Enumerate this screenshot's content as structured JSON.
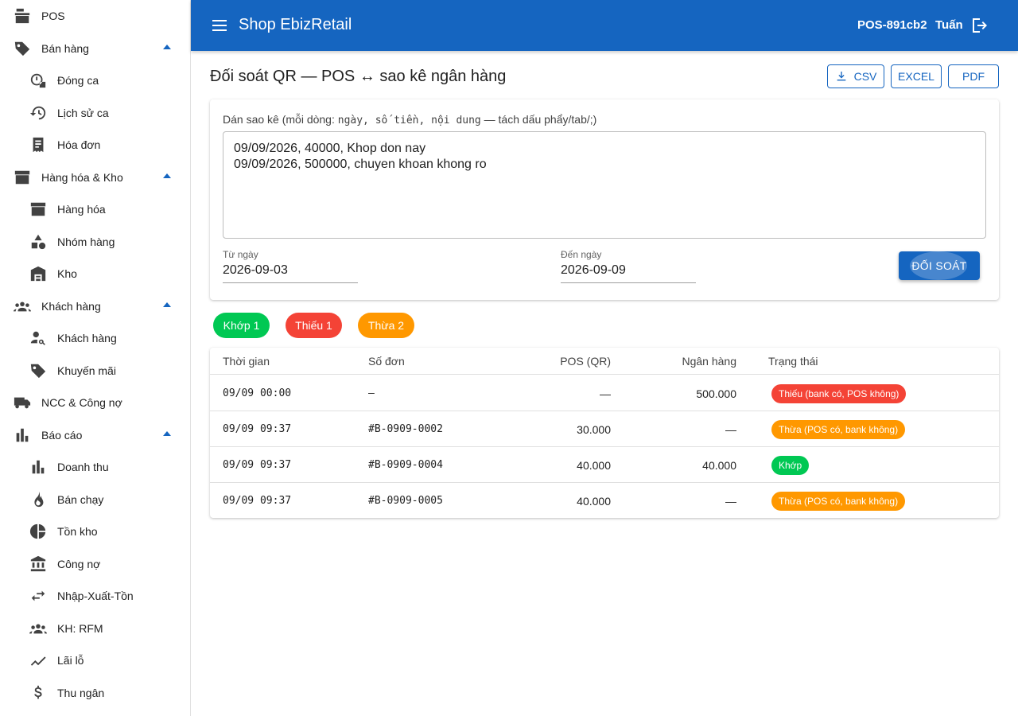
{
  "sidebar": {
    "items": [
      {
        "label": "POS",
        "icon": "cash-register-icon",
        "level": "top",
        "expandable": false
      },
      {
        "label": "Bán hàng",
        "icon": "tag-icon",
        "level": "top",
        "expandable": true
      },
      {
        "label": "Đóng ca",
        "icon": "clock-lock-icon",
        "level": "sub"
      },
      {
        "label": "Lịch sử ca",
        "icon": "history-icon",
        "level": "sub"
      },
      {
        "label": "Hóa đơn",
        "icon": "receipt-icon",
        "level": "sub"
      },
      {
        "label": "Hàng hóa & Kho",
        "icon": "archive-icon",
        "level": "top",
        "expandable": true
      },
      {
        "label": "Hàng hóa",
        "icon": "archive-icon",
        "level": "sub"
      },
      {
        "label": "Nhóm hàng",
        "icon": "category-shapes-icon",
        "level": "sub"
      },
      {
        "label": "Kho",
        "icon": "warehouse-icon",
        "level": "sub"
      },
      {
        "label": "Khách hàng",
        "icon": "people-icon",
        "level": "top",
        "expandable": true
      },
      {
        "label": "Khách hàng",
        "icon": "person-search-icon",
        "level": "sub"
      },
      {
        "label": "Khuyến mãi",
        "icon": "tag-icon",
        "level": "sub"
      },
      {
        "label": "NCC & Công nợ",
        "icon": "truck-icon",
        "level": "top",
        "expandable": false
      },
      {
        "label": "Báo cáo",
        "icon": "bar-chart-icon",
        "level": "top",
        "expandable": true
      },
      {
        "label": "Doanh thu",
        "icon": "bar-chart-icon",
        "level": "sub"
      },
      {
        "label": "Bán chạy",
        "icon": "fire-icon",
        "level": "sub"
      },
      {
        "label": "Tồn kho",
        "icon": "pie-chart-icon",
        "level": "sub"
      },
      {
        "label": "Công nợ",
        "icon": "bank-icon",
        "level": "sub"
      },
      {
        "label": "Nhập-Xuất-Tồn",
        "icon": "swap-arrows-icon",
        "level": "sub"
      },
      {
        "label": "KH: RFM",
        "icon": "people-icon",
        "level": "sub"
      },
      {
        "label": "Lãi lỗ",
        "icon": "trending-icon",
        "level": "sub"
      },
      {
        "label": "Thu ngân",
        "icon": "dollar-icon",
        "level": "sub"
      }
    ]
  },
  "header": {
    "title": "Shop EbizRetail",
    "device_id": "POS-891cb2",
    "user": "Tuấn"
  },
  "page": {
    "title": "Đối soát QR — POS ↔ sao kê ngân hàng",
    "export_buttons": {
      "csv": "CSV",
      "excel": "EXCEL",
      "pdf": "PDF"
    }
  },
  "form": {
    "paste_label_prefix": "Dán sao kê (mỗi dòng: ",
    "paste_label_mono": "ngày, số tiền, nội dung",
    "paste_label_suffix": " — tách dấu phẩy/tab/;)",
    "paste_value": "09/09/2026, 40000, Khop don nay\n09/09/2026, 500000, chuyen khoan khong ro",
    "from_label": "Từ ngày",
    "from_value": "2026-09-03",
    "to_label": "Đến ngày",
    "to_value": "2026-09-09",
    "reconcile_button": "ĐỐI SOÁT"
  },
  "summary_chips": [
    {
      "label": "Khớp 1",
      "color": "#00c853"
    },
    {
      "label": "Thiếu 1",
      "color": "#f44336"
    },
    {
      "label": "Thừa 2",
      "color": "#ff9800"
    }
  ],
  "table": {
    "headers": {
      "time": "Thời gian",
      "order": "Số đơn",
      "pos": "POS (QR)",
      "bank": "Ngân hàng",
      "status": "Trạng thái"
    },
    "rows": [
      {
        "time": "09/09 00:00",
        "order": "–",
        "pos": "—",
        "bank": "500.000",
        "status": "Thiếu (bank có, POS không)",
        "status_color": "#f44336"
      },
      {
        "time": "09/09 09:37",
        "order": "#B-0909-0002",
        "pos": "30.000",
        "bank": "—",
        "status": "Thừa (POS có, bank không)",
        "status_color": "#ff9800"
      },
      {
        "time": "09/09 09:37",
        "order": "#B-0909-0004",
        "pos": "40.000",
        "bank": "40.000",
        "status": "Khớp",
        "status_color": "#00c853"
      },
      {
        "time": "09/09 09:37",
        "order": "#B-0909-0005",
        "pos": "40.000",
        "bank": "—",
        "status": "Thừa (POS có, bank không)",
        "status_color": "#ff9800"
      }
    ]
  },
  "colors": {
    "primary": "#1565c0",
    "success": "#00c853",
    "error": "#f44336",
    "warning": "#ff9800"
  }
}
